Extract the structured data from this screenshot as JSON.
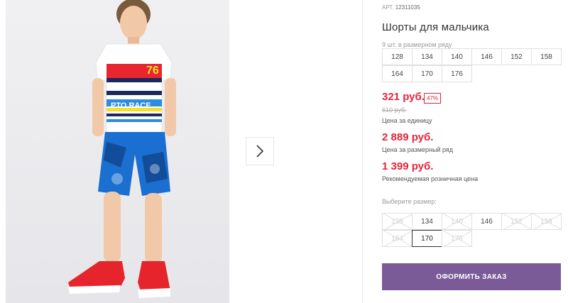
{
  "product": {
    "sku_label": "АРТ.",
    "sku": "12311035",
    "title": "Шорты для мальчика",
    "range_label": "9 шт. в размерном ряду",
    "range_sizes": [
      "128",
      "134",
      "140",
      "146",
      "152",
      "158",
      "164",
      "170",
      "176"
    ]
  },
  "pricing": {
    "unit_price": "321 руб.",
    "discount": "47%",
    "old_price": "610 руб.",
    "unit_note": "Цена за единицу",
    "range_price": "2 889 руб.",
    "range_note": "Цена за размерный ряд",
    "rrp_price": "1 399 руб.",
    "rrp_note": "Рекомендуемая розничная цена"
  },
  "size_picker": {
    "label": "Выберите размер:",
    "sizes": [
      {
        "label": "128",
        "state": "disabled"
      },
      {
        "label": "134",
        "state": "available"
      },
      {
        "label": "140",
        "state": "disabled"
      },
      {
        "label": "146",
        "state": "available"
      },
      {
        "label": "152",
        "state": "disabled"
      },
      {
        "label": "158",
        "state": "disabled"
      },
      {
        "label": "164",
        "state": "disabled"
      },
      {
        "label": "170",
        "state": "selected"
      },
      {
        "label": "176",
        "state": "disabled"
      }
    ]
  },
  "actions": {
    "order_button": "ОФОРМИТЬ ЗАКАЗ"
  },
  "gallery": {
    "next_icon": "chevron-right-icon"
  },
  "colors": {
    "price": "#e3243b",
    "button": "#7a5b98"
  }
}
